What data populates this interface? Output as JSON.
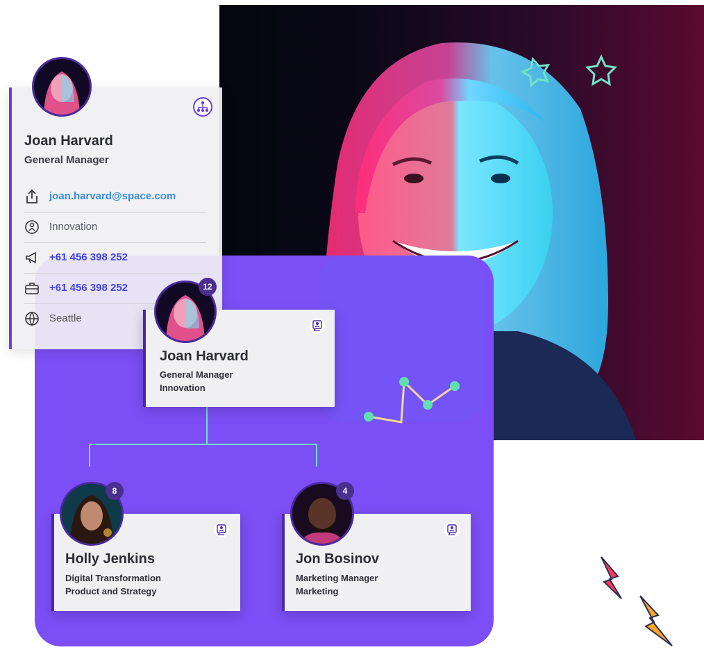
{
  "profile": {
    "name": "Joan Harvard",
    "role": "General Manager",
    "details": [
      {
        "icon": "share-icon",
        "text": "joan.harvard@space.com"
      },
      {
        "icon": "department-icon",
        "text": "Innovation"
      },
      {
        "icon": "megaphone-icon",
        "text": "+61 456 398 252"
      },
      {
        "icon": "briefcase-icon",
        "text": "+61 456 398 252"
      },
      {
        "icon": "globe-icon",
        "text": "Seattle"
      }
    ]
  },
  "org_chart": {
    "root": {
      "name": "Joan Harvard",
      "title": "General Manager",
      "department": "Innovation",
      "reports": "12"
    },
    "children": [
      {
        "name": "Holly Jenkins",
        "title": "Digital Transformation",
        "department": "Product and Strategy",
        "reports": "8"
      },
      {
        "name": "Jon Bosinov",
        "title": "Marketing Manager",
        "department": "Marketing",
        "reports": "4"
      }
    ]
  },
  "colors": {
    "accent": "#7b4ff5",
    "dark_accent": "#4a2aa0",
    "link": "#3b8be0",
    "phone": "#4343e8",
    "connector": "#6fe3c8"
  }
}
